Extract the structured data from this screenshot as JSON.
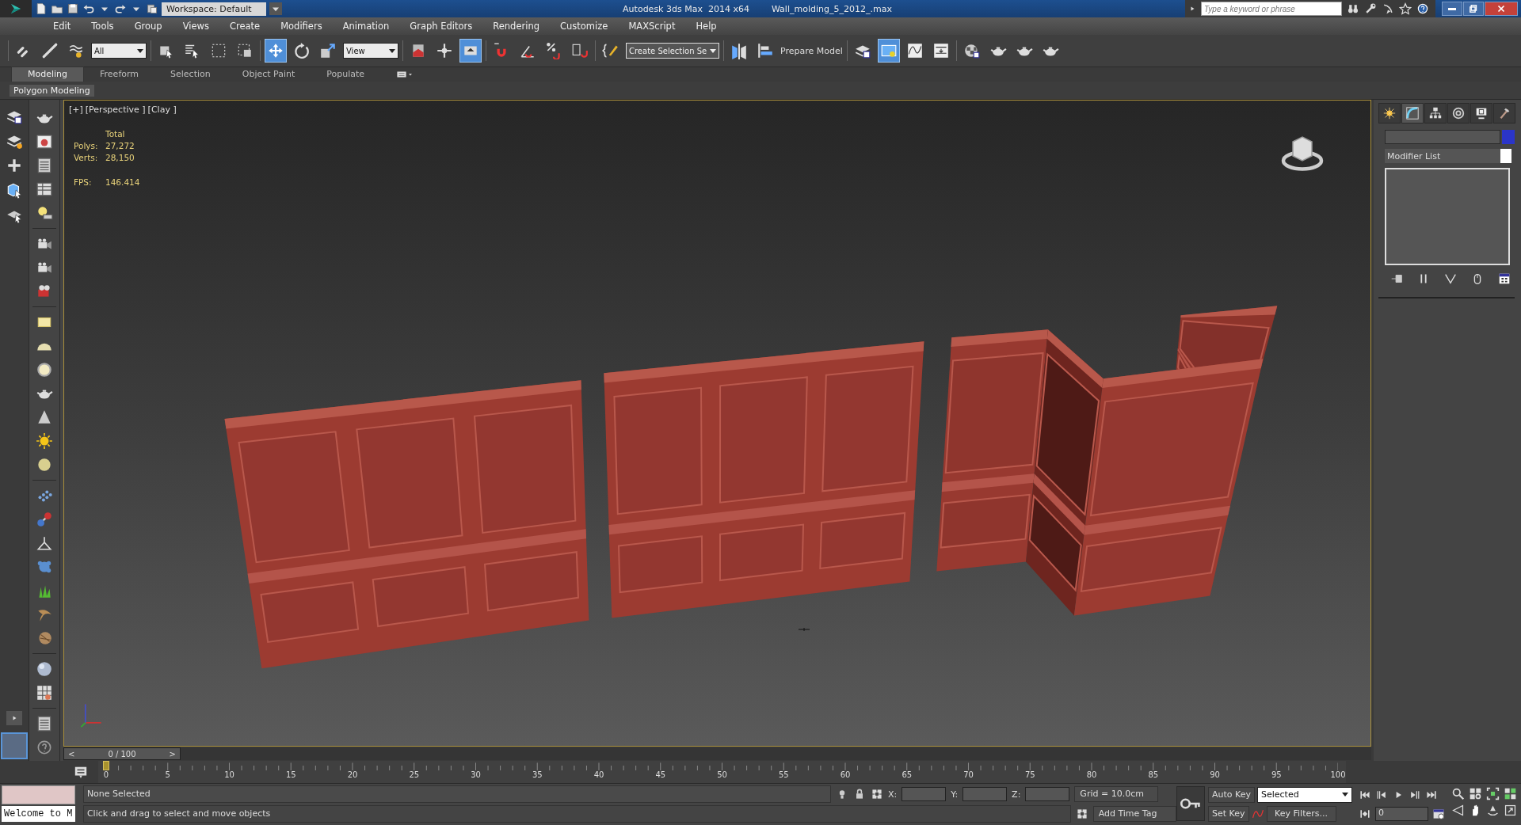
{
  "title_bar": {
    "workspace": "Workspace: Default",
    "app_title": "Autodesk 3ds Max  2014 x64",
    "file_name": "Wall_molding_5_2012_.max",
    "search": {
      "placeholder": "Type a keyword or phrase"
    }
  },
  "menu": [
    "Edit",
    "Tools",
    "Group",
    "Views",
    "Create",
    "Modifiers",
    "Animation",
    "Graph Editors",
    "Rendering",
    "Customize",
    "MAXScript",
    "Help"
  ],
  "main_toolbar": [
    {
      "kind": "link",
      "selected": false
    },
    {
      "kind": "unlink",
      "selected": false
    },
    {
      "kind": "bind",
      "selected": false
    },
    {
      "kind": "dropdown",
      "value": "All"
    },
    {
      "kind": "select",
      "selected": false
    },
    {
      "kind": "select-by-name",
      "selected": false
    },
    {
      "kind": "rect-region",
      "selected": false
    },
    {
      "kind": "window-crossing",
      "selected": false
    },
    {
      "kind": "move",
      "selected": true
    },
    {
      "kind": "rotate",
      "selected": false
    },
    {
      "kind": "scale",
      "selected": false
    },
    {
      "kind": "dropdown",
      "value": "View"
    },
    {
      "kind": "pivot",
      "selected": false
    },
    {
      "kind": "manipulate",
      "selected": false
    },
    {
      "kind": "keyboard",
      "selected": true
    },
    {
      "kind": "snap",
      "selected": false
    },
    {
      "kind": "angle-snap",
      "selected": false
    },
    {
      "kind": "percent-snap",
      "selected": false
    },
    {
      "kind": "spinner-snap",
      "selected": false
    },
    {
      "kind": "edit-named",
      "selected": false
    },
    {
      "kind": "dropdown",
      "value": "Create Selection Se"
    },
    {
      "kind": "mirror",
      "selected": false
    },
    {
      "kind": "align",
      "selected": false
    },
    {
      "kind": "label",
      "value": "Prepare Model"
    },
    {
      "kind": "layers",
      "selected": false
    },
    {
      "kind": "scene-explorer",
      "selected": true
    },
    {
      "kind": "curve-editor",
      "selected": false
    },
    {
      "kind": "schematic",
      "selected": false
    },
    {
      "kind": "material-editor",
      "selected": false
    },
    {
      "kind": "render-setup",
      "selected": false
    },
    {
      "kind": "rendered-frame",
      "selected": false
    },
    {
      "kind": "render",
      "selected": false
    }
  ],
  "ribbon": {
    "tabs": [
      {
        "label": "Modeling",
        "selected": true
      },
      {
        "label": "Freeform",
        "selected": false
      },
      {
        "label": "Selection",
        "selected": false
      },
      {
        "label": "Object Paint",
        "selected": false
      },
      {
        "label": "Populate",
        "selected": false
      }
    ],
    "panel": "Polygon Modeling"
  },
  "viewport": {
    "labels": [
      "[+]",
      "[Perspective ]",
      "[Clay ]"
    ],
    "stats_header": "Total",
    "stats": [
      {
        "label": "Polys:",
        "value": "27,272"
      },
      {
        "label": "Verts:",
        "value": "28,150"
      }
    ],
    "fps": {
      "label": "FPS:",
      "value": "146.414"
    }
  },
  "command_panel": {
    "tabs": [
      {
        "kind": "create",
        "selected": false
      },
      {
        "kind": "modify",
        "selected": true
      },
      {
        "kind": "hierarchy",
        "selected": false
      },
      {
        "kind": "motion",
        "selected": false
      },
      {
        "kind": "display",
        "selected": false
      },
      {
        "kind": "utilities",
        "selected": false
      }
    ],
    "modifier_list": "Modifier List"
  },
  "time_slider": {
    "prev": "<",
    "position": "0 / 100",
    "next": ">",
    "level": 0
  },
  "track_bar": {
    "ticks": [
      "0",
      "5",
      "10",
      "15",
      "20",
      "25",
      "30",
      "35",
      "40",
      "45",
      "50",
      "55",
      "60",
      "65",
      "70",
      "75",
      "80",
      "85",
      "90",
      "95",
      "100"
    ]
  },
  "status_bar": {
    "listener": "Welcome to M",
    "selection": "None Selected",
    "prompt": "Click and drag to select and move objects",
    "coords": [
      {
        "label": "X:"
      },
      {
        "label": "Y:"
      },
      {
        "label": "Z:"
      }
    ],
    "grid": "Grid = 10.0cm",
    "time_tag": "Add Time Tag",
    "auto_key": "Auto Key",
    "set_key": "Set Key",
    "key_mode": "Selected",
    "key_filters": "Key Filters...",
    "frame": "0"
  }
}
